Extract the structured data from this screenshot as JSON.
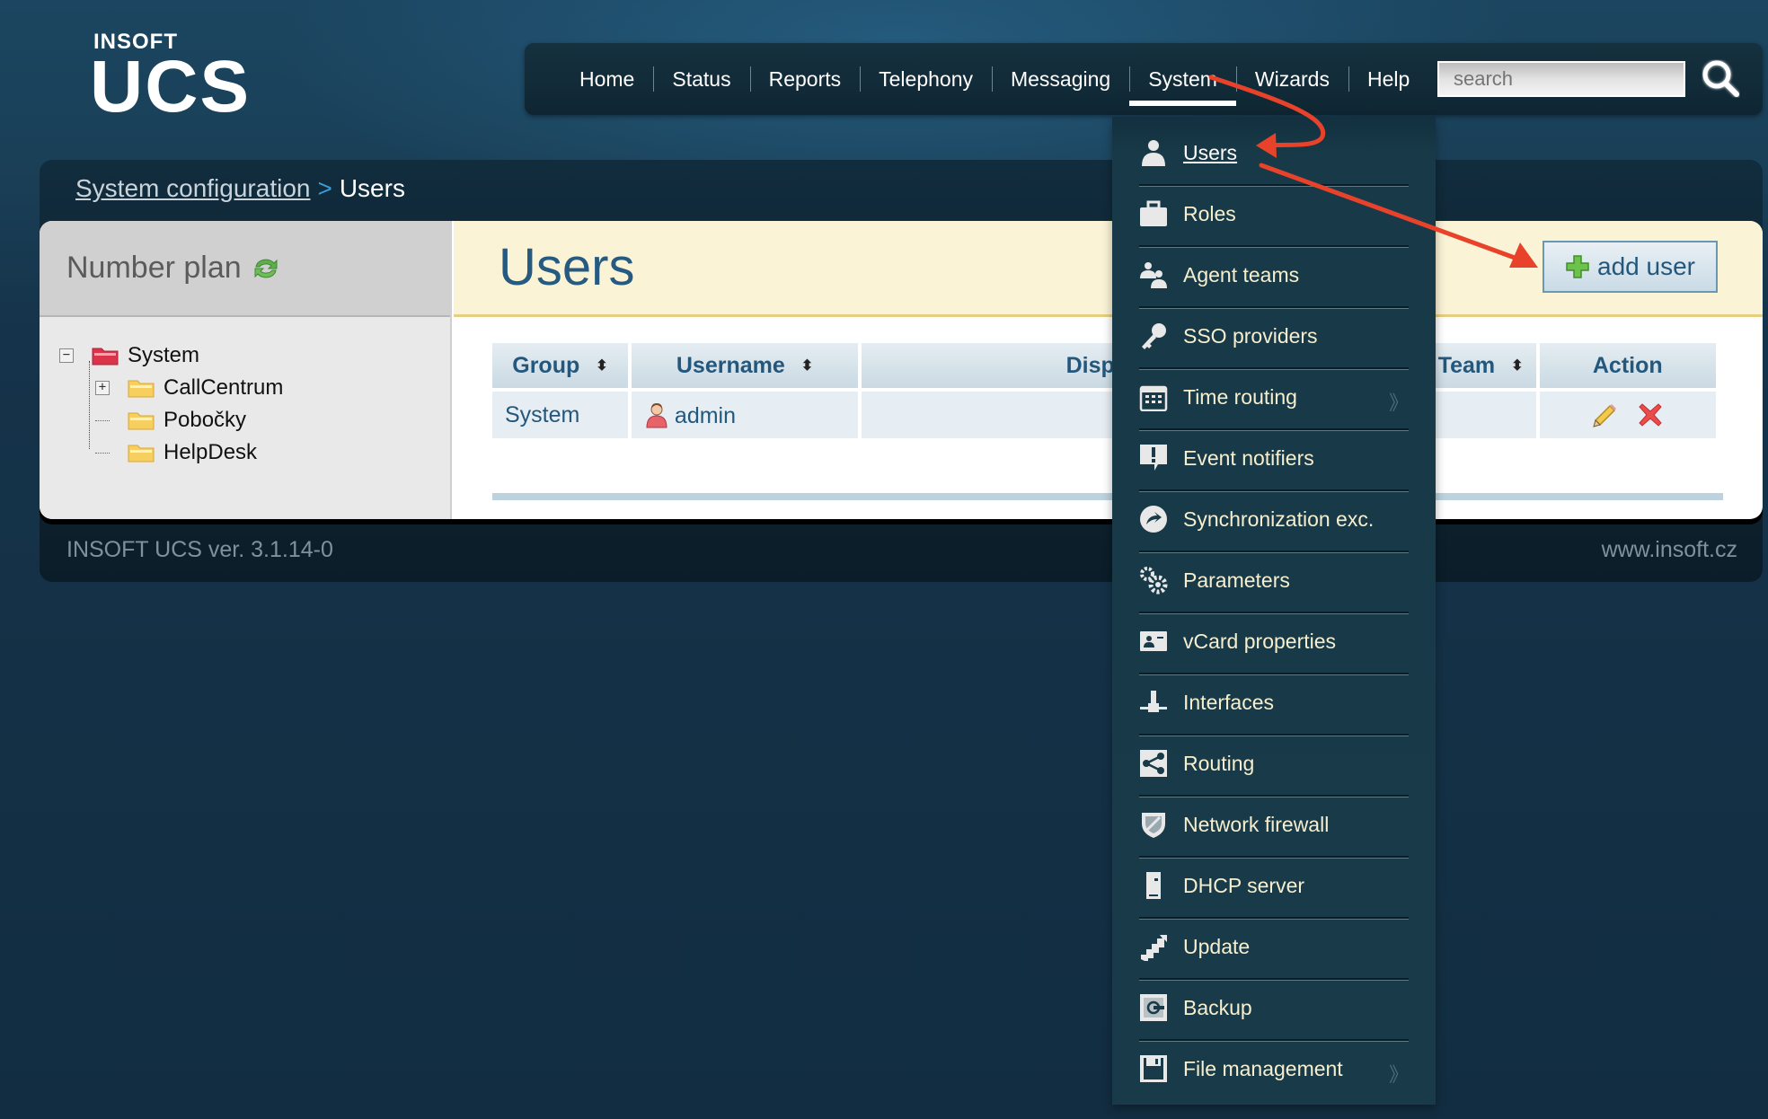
{
  "logo": {
    "brand": "INSOFT",
    "product": "UCS"
  },
  "nav": {
    "items": [
      {
        "label": "Home",
        "active": false
      },
      {
        "label": "Status",
        "active": false
      },
      {
        "label": "Reports",
        "active": false
      },
      {
        "label": "Telephony",
        "active": false
      },
      {
        "label": "Messaging",
        "active": false
      },
      {
        "label": "System",
        "active": true
      },
      {
        "label": "Wizards",
        "active": false
      },
      {
        "label": "Help",
        "active": false
      }
    ],
    "search": {
      "placeholder": "search",
      "value": "",
      "icon": "search-icon"
    }
  },
  "breadcrumb": {
    "parent": "System configuration",
    "separator": ">",
    "current": "Users"
  },
  "sidebar": {
    "title": "Number plan",
    "refresh_icon": "refresh-icon",
    "tree": {
      "root": {
        "label": "System",
        "expanded": true,
        "toggle": "−"
      },
      "children": [
        {
          "label": "CallCentrum",
          "expandable": true,
          "toggle": "+"
        },
        {
          "label": "Pobočky",
          "expandable": false
        },
        {
          "label": "HelpDesk",
          "expandable": false
        }
      ]
    }
  },
  "main": {
    "title": "Users",
    "add_button": "add user",
    "table": {
      "columns": [
        {
          "label": "Group",
          "sortable": true
        },
        {
          "label": "Username",
          "sortable": true
        },
        {
          "label": "Display name",
          "sortable": false
        },
        {
          "label": "Team",
          "sortable": true
        },
        {
          "label": "Action",
          "sortable": false
        }
      ],
      "sort_glyph": "⬍",
      "rows": [
        {
          "group": "System",
          "username": "admin",
          "display_name": "",
          "team": "",
          "actions": [
            "edit",
            "delete"
          ]
        }
      ]
    }
  },
  "footer": {
    "version": "INSOFT UCS ver. 3.1.14-0",
    "website": "www.insoft.cz"
  },
  "dropdown": {
    "parent_menu": "System",
    "submenu_glyph": "》",
    "items": [
      {
        "label": "Users",
        "icon": "user-icon",
        "active": true,
        "submenu": false
      },
      {
        "label": "Roles",
        "icon": "briefcase-icon",
        "active": false,
        "submenu": false
      },
      {
        "label": "Agent teams",
        "icon": "team-icon",
        "active": false,
        "submenu": false
      },
      {
        "label": "SSO providers",
        "icon": "key-icon",
        "active": false,
        "submenu": false
      },
      {
        "label": "Time routing",
        "icon": "calendar-icon",
        "active": false,
        "submenu": true
      },
      {
        "label": "Event notifiers",
        "icon": "alert-icon",
        "active": false,
        "submenu": false
      },
      {
        "label": "Synchronization exc.",
        "icon": "sync-icon",
        "active": false,
        "submenu": false
      },
      {
        "label": "Parameters",
        "icon": "gears-icon",
        "active": false,
        "submenu": false
      },
      {
        "label": "vCard properties",
        "icon": "vcard-icon",
        "active": false,
        "submenu": false
      },
      {
        "label": "Interfaces",
        "icon": "network-interface-icon",
        "active": false,
        "submenu": false
      },
      {
        "label": "Routing",
        "icon": "share-routing-icon",
        "active": false,
        "submenu": false
      },
      {
        "label": "Network firewall",
        "icon": "shield-icon",
        "active": false,
        "submenu": false
      },
      {
        "label": "DHCP server",
        "icon": "server-icon",
        "active": false,
        "submenu": false
      },
      {
        "label": "Update",
        "icon": "stairs-update-icon",
        "active": false,
        "submenu": false
      },
      {
        "label": "Backup",
        "icon": "safe-backup-icon",
        "active": false,
        "submenu": false
      },
      {
        "label": "File management",
        "icon": "floppy-icon",
        "active": false,
        "submenu": true
      }
    ]
  },
  "colors": {
    "accent_title": "#265a80",
    "menu_text": "#f6efcf",
    "annotation_arrow": "#e8432a",
    "header_band": "#fbf3d6"
  }
}
